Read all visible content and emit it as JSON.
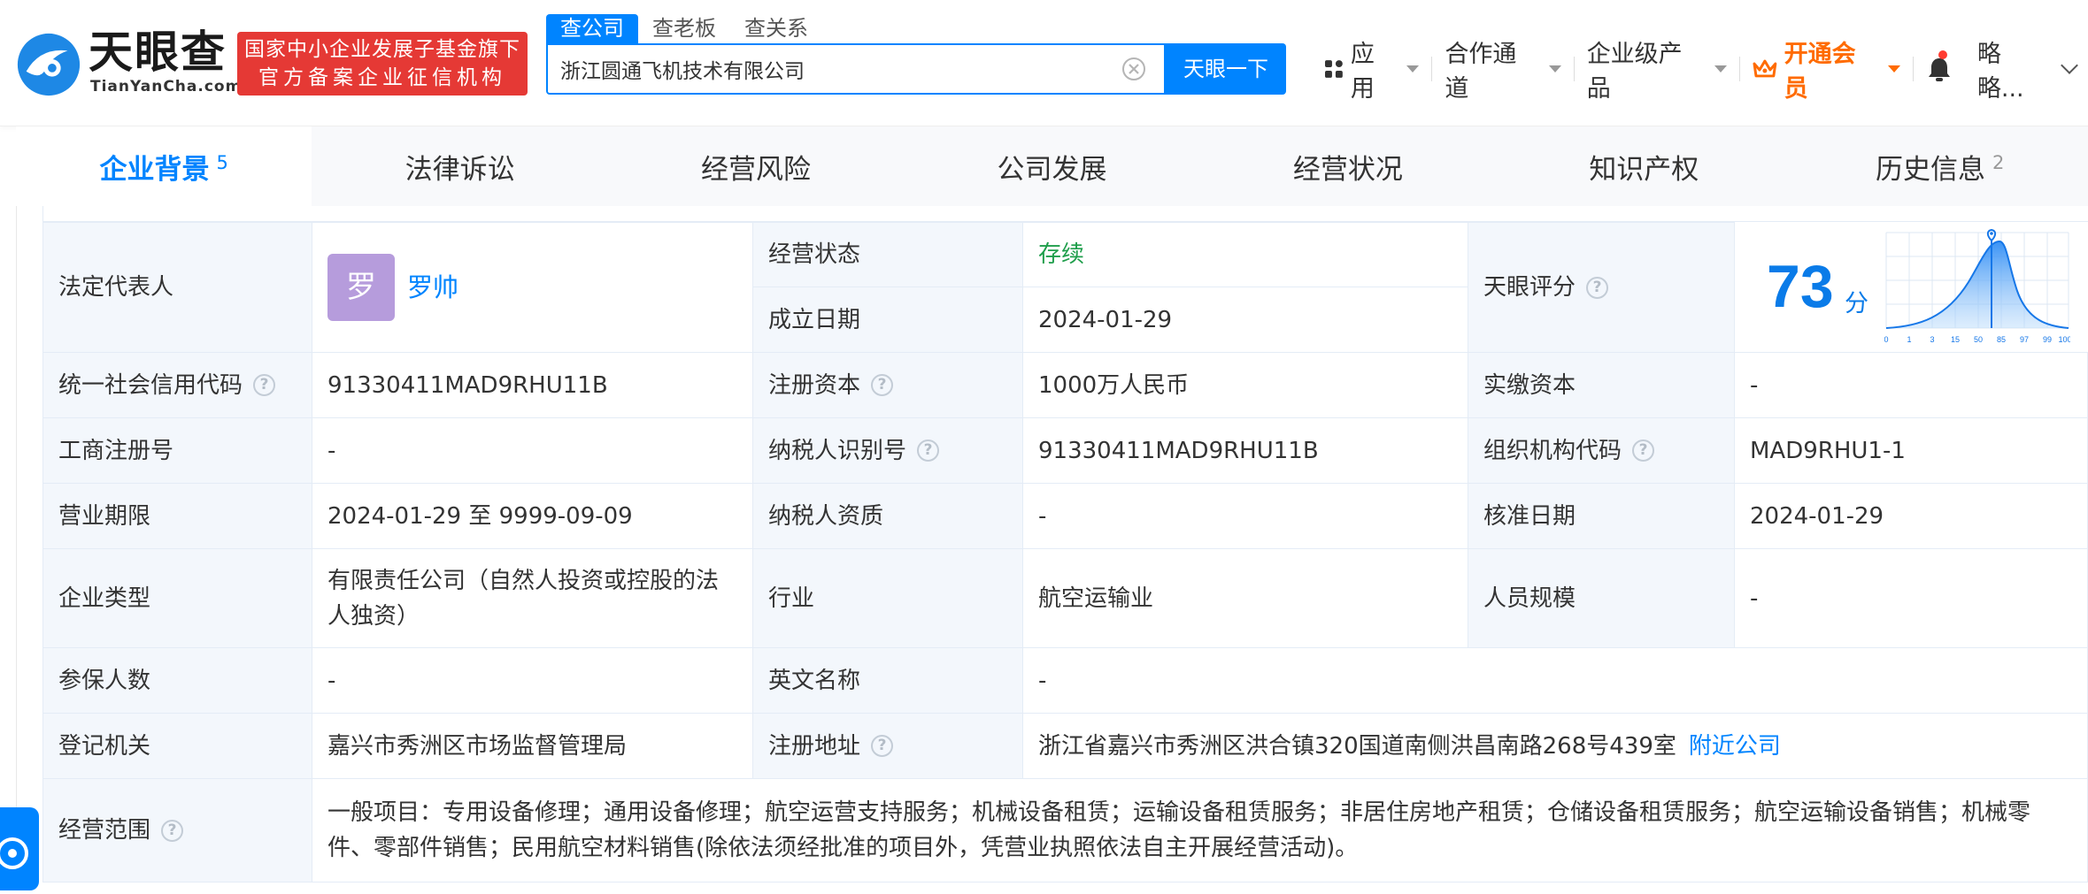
{
  "brand": {
    "name": "天眼查",
    "domain": "TianYanCha.com",
    "badge_line1": "国家中小企业发展子基金旗下",
    "badge_line2": "官方备案企业征信机构"
  },
  "search": {
    "tabs": [
      "查公司",
      "查老板",
      "查关系"
    ],
    "value": "浙江圆通飞机技术有限公司",
    "button": "天眼一下"
  },
  "nav": {
    "apps": "应用",
    "partner": "合作通道",
    "enterprise": "企业级产品",
    "vip": "开通会员",
    "user": "略略..."
  },
  "tabs": [
    {
      "label": "企业背景",
      "count": "5"
    },
    {
      "label": "法律诉讼",
      "count": ""
    },
    {
      "label": "经营风险",
      "count": ""
    },
    {
      "label": "公司发展",
      "count": ""
    },
    {
      "label": "经营状况",
      "count": ""
    },
    {
      "label": "知识产权",
      "count": ""
    },
    {
      "label": "历史信息",
      "count": "2"
    }
  ],
  "info": {
    "legal_rep_label": "法定代表人",
    "legal_rep_avatar": "罗",
    "legal_rep_name": "罗帅",
    "status_label": "经营状态",
    "status_value": "存续",
    "founded_label": "成立日期",
    "founded_value": "2024-01-29",
    "score_label": "天眼评分",
    "score_value": "73",
    "score_unit": "分",
    "score_ticks": [
      "0",
      "1",
      "3",
      "15",
      "50",
      "85",
      "97",
      "99",
      "100"
    ],
    "credit_code_label": "统一社会信用代码",
    "credit_code_value": "91330411MAD9RHU11B",
    "reg_capital_label": "注册资本",
    "reg_capital_value": "1000万人民币",
    "paid_capital_label": "实缴资本",
    "paid_capital_value": "-",
    "biz_reg_no_label": "工商注册号",
    "biz_reg_no_value": "-",
    "taxpayer_id_label": "纳税人识别号",
    "taxpayer_id_value": "91330411MAD9RHU11B",
    "org_code_label": "组织机构代码",
    "org_code_value": "MAD9RHU1-1",
    "term_label": "营业期限",
    "term_value": "2024-01-29 至 9999-09-09",
    "taxpayer_qual_label": "纳税人资质",
    "taxpayer_qual_value": "-",
    "approval_date_label": "核准日期",
    "approval_date_value": "2024-01-29",
    "type_label": "企业类型",
    "type_value": "有限责任公司（自然人投资或控股的法人独资）",
    "industry_label": "行业",
    "industry_value": "航空运输业",
    "staff_size_label": "人员规模",
    "staff_size_value": "-",
    "insured_label": "参保人数",
    "insured_value": "-",
    "english_name_label": "英文名称",
    "english_name_value": "-",
    "registrar_label": "登记机关",
    "registrar_value": "嘉兴市秀洲区市场监督管理局",
    "address_label": "注册地址",
    "address_value": "浙江省嘉兴市秀洲区洪合镇320国道南侧洪昌南路268号439室",
    "nearby_link": "附近公司",
    "scope_label": "经营范围",
    "scope_value": "一般项目：专用设备修理；通用设备修理；航空运营支持服务；机械设备租赁；运输设备租赁服务；非居住房地产租赁；仓储设备租赁服务；航空运输设备销售；机械零件、零部件销售；民用航空材料销售(除依法须经批准的项目外，凭营业执照依法自主开展经营活动)。"
  },
  "colors": {
    "brand_blue": "#0084ff",
    "badge_red": "#e53935",
    "status_green": "#1f9e4b",
    "vip_orange": "#ff6b00",
    "label_bg": "#f3f7fc"
  },
  "icons": [
    "logo-mark-icon",
    "clear-icon",
    "apps-icon",
    "crown-icon",
    "bell-icon",
    "question-icon",
    "location-pin-icon",
    "chat-icon"
  ]
}
